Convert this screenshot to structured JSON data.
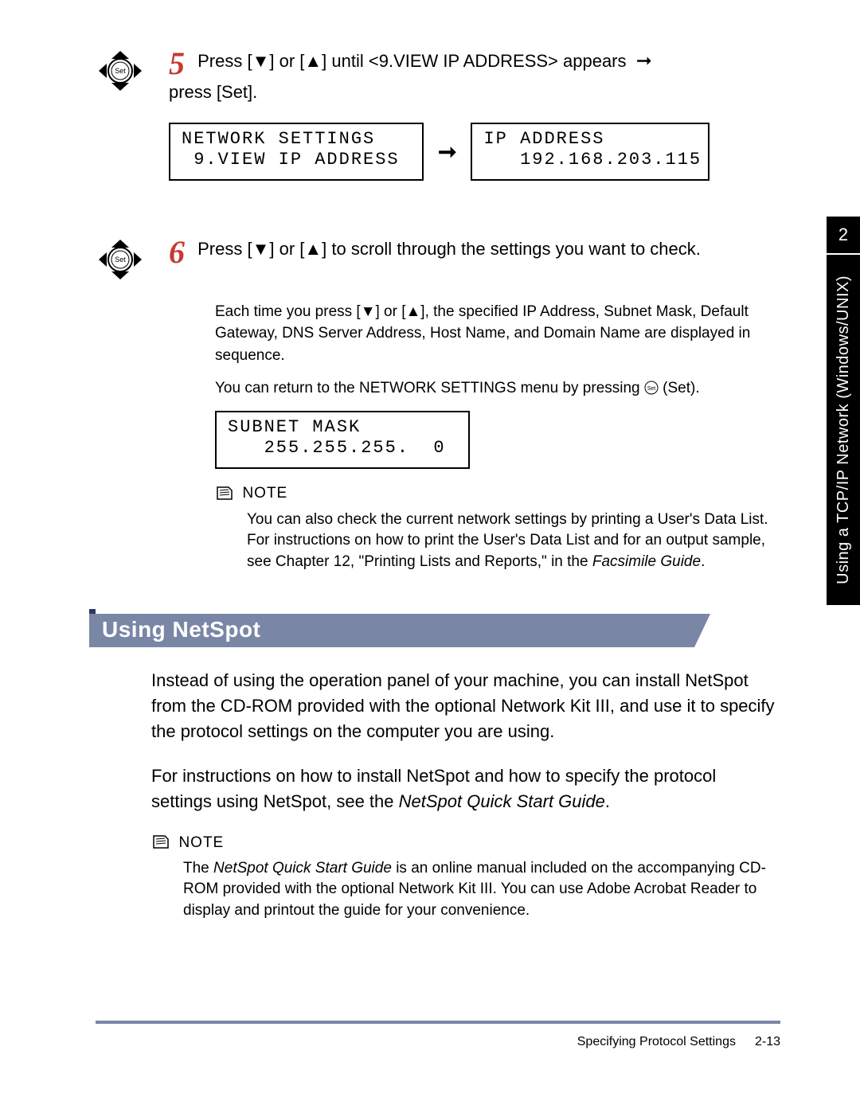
{
  "step5": {
    "num": "5",
    "text_a": "Press [",
    "text_b": "] or [",
    "text_c": "] until <9.VIEW IP ADDRESS> appears",
    "text_d": "press [Set].",
    "lcd1_line1": "NETWORK SETTINGS",
    "lcd1_line2": " 9.VIEW IP ADDRESS",
    "lcd2_line1": "IP ADDRESS",
    "lcd2_line2": "   192.168.203.115"
  },
  "step6": {
    "num": "6",
    "text_a": "Press [",
    "text_b": "] or [",
    "text_c": "] to scroll through the settings you want to check.",
    "para1": "Each time you press [▼] or [▲], the specified IP Address, Subnet Mask, Default Gateway, DNS Server Address, Host Name, and Domain Name are displayed in sequence.",
    "para2_a": "You can return to the NETWORK SETTINGS menu by pressing ",
    "para2_b": " (Set).",
    "lcd_line1": "SUBNET MASK",
    "lcd_line2": "   255.255.255.  0",
    "note_label": "NOTE",
    "note_text_a": "You can also check the current network settings by printing a User's Data List. For instructions on how to print the User's Data List and for an output sample, see Chapter 12, \"Printing Lists and Reports,\" in the ",
    "note_text_b": "Facsimile Guide",
    "note_text_c": "."
  },
  "section": {
    "heading": "Using NetSpot",
    "para1": "Instead of using the operation panel of your machine, you can install NetSpot from the CD-ROM provided with the optional Network Kit III, and use it to specify the protocol settings on the computer you are using.",
    "para2_a": "For instructions on how to install NetSpot and how to specify the protocol settings using NetSpot, see the ",
    "para2_b": "NetSpot Quick Start Guide",
    "para2_c": ".",
    "note_label": "NOTE",
    "note_text_a": "The ",
    "note_text_b": "NetSpot Quick Start Guide",
    "note_text_c": " is an online manual included on the accompanying CD-ROM provided with the optional Network Kit III. You can use Adobe Acrobat Reader to display and printout the guide for your convenience."
  },
  "footer": {
    "title": "Specifying Protocol Settings",
    "page": "2-13"
  },
  "sidetab": {
    "num": "2",
    "label": "Using a TCP/IP Network (Windows/UNIX)"
  },
  "icons": {
    "set_label": "Set"
  }
}
